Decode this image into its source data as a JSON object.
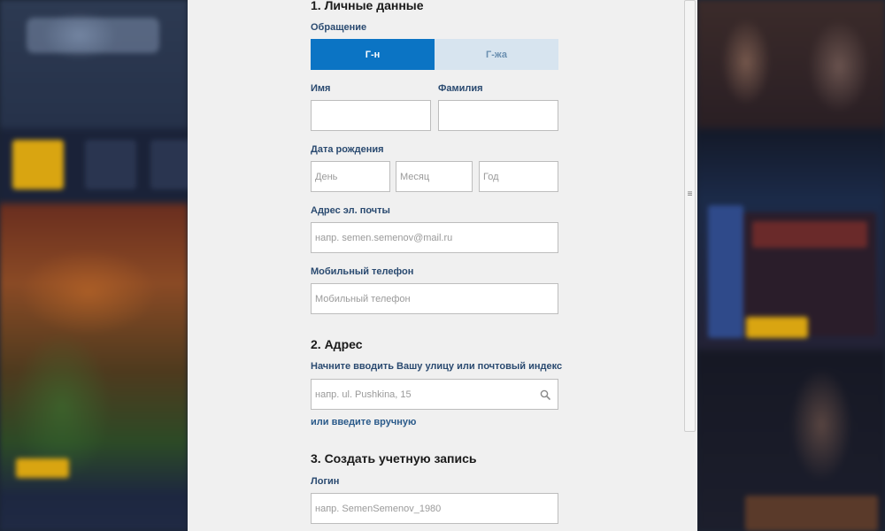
{
  "section1": {
    "title": "1. Личные данные",
    "salutation_label": "Обращение",
    "salutation_options": [
      "Г-н",
      "Г-жа"
    ],
    "selected_salutation": "Г-н",
    "first_name_label": "Имя",
    "last_name_label": "Фамилия",
    "first_name_value": "",
    "last_name_value": "",
    "dob_label": "Дата рождения",
    "dob_day_placeholder": "День",
    "dob_month_placeholder": "Месяц",
    "dob_year_placeholder": "Год",
    "email_label": "Адрес эл. почты",
    "email_placeholder": "напр. semen.semenov@mail.ru",
    "phone_label": "Мобильный телефон",
    "phone_placeholder": "Мобильный телефон"
  },
  "section2": {
    "title": "2. Адрес",
    "address_search_label": "Начните вводить Вашу улицу или почтовый индекс",
    "address_search_placeholder": "напр. ul. Pushkina, 15",
    "manual_entry_link": "или введите вручную"
  },
  "section3": {
    "title": "3. Создать учетную запись",
    "login_label": "Логин",
    "login_placeholder": "напр. SemenSemenov_1980"
  },
  "colors": {
    "accent": "#0b74c4",
    "label": "#2a4a70",
    "inactive_toggle": "#d7e4ef",
    "modal_bg": "#f0f0f0"
  },
  "icons": {
    "address_search": "search-icon"
  }
}
